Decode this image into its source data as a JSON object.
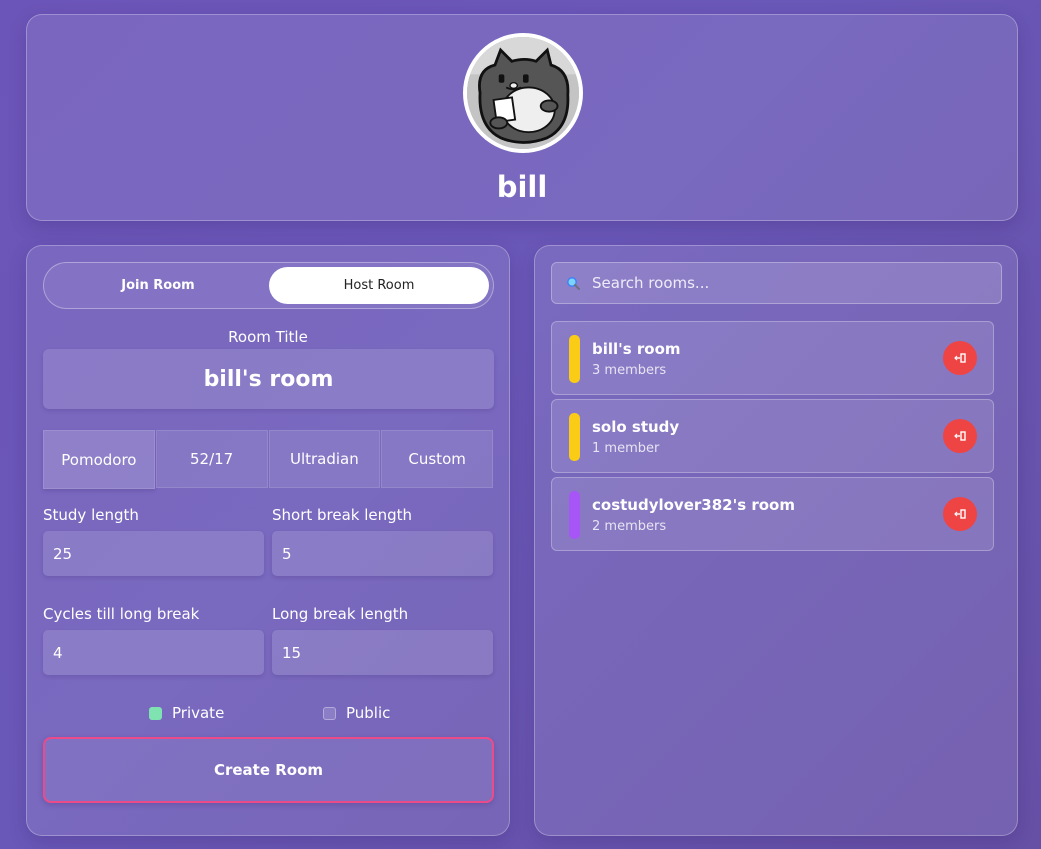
{
  "profile": {
    "username": "bill",
    "avatar_icon": "cartoon-cat-avatar"
  },
  "host_panel": {
    "tabs": {
      "join_label": "Join Room",
      "host_label": "Host Room",
      "active": "Host Room"
    },
    "room_title_label": "Room Title",
    "room_title_value": "bill's room",
    "presets": [
      {
        "label": "Pomodoro",
        "active": true
      },
      {
        "label": "52/17",
        "active": false
      },
      {
        "label": "Ultradian",
        "active": false
      },
      {
        "label": "Custom",
        "active": false
      }
    ],
    "study_length": {
      "label": "Study length",
      "value": "25"
    },
    "short_break": {
      "label": "Short break length",
      "value": "5"
    },
    "cycles": {
      "label": "Cycles till long break",
      "value": "4"
    },
    "long_break": {
      "label": "Long break length",
      "value": "15"
    },
    "visibility": {
      "private_label": "Private",
      "public_label": "Public",
      "selected": "Private"
    },
    "create_label": "Create Room"
  },
  "rooms_panel": {
    "search_placeholder": "Search rooms...",
    "rooms": [
      {
        "name": "bill's room",
        "members": "3 members",
        "color": "#facc15"
      },
      {
        "name": "solo study",
        "members": "1 member",
        "color": "#facc15"
      },
      {
        "name": "costudylover382's room",
        "members": "2 members",
        "color": "#a855f7"
      }
    ],
    "leave_icon": "leave-icon"
  },
  "colors": {
    "background": "#6a55b6",
    "accent_pink": "#ec4b8a",
    "leave_red": "#ef4444",
    "private_green": "#7ee3b1"
  }
}
